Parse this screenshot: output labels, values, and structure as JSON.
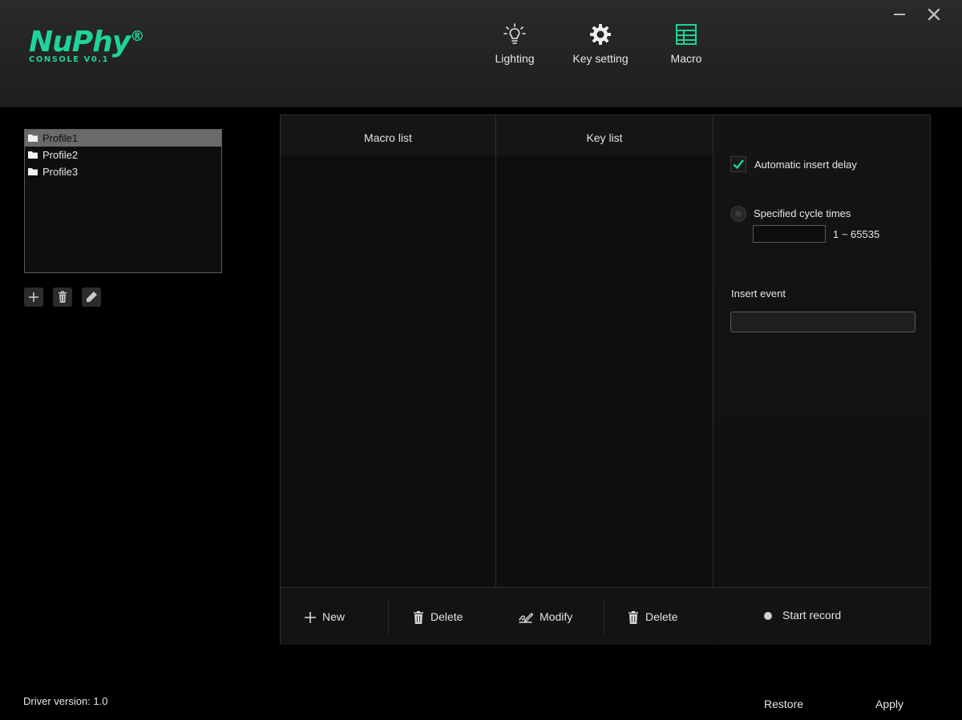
{
  "brand": {
    "name": "NuPhy",
    "registered": "®",
    "subtitle": "CONSOLE V0.1",
    "accent_color": "#1fd39a"
  },
  "nav": {
    "tabs": [
      {
        "label": "Lighting",
        "icon": "lightbulb-icon",
        "active": false
      },
      {
        "label": "Key setting",
        "icon": "gear-icon",
        "active": false
      },
      {
        "label": "Macro",
        "icon": "table-icon",
        "active": true
      }
    ]
  },
  "window_controls": {
    "minimize": "minimize-icon",
    "close": "close-icon"
  },
  "profiles": {
    "items": [
      {
        "label": "Profile1",
        "selected": true
      },
      {
        "label": "Profile2",
        "selected": false
      },
      {
        "label": "Profile3",
        "selected": false
      }
    ],
    "actions": [
      "add-icon",
      "trash-icon",
      "pencil-icon"
    ]
  },
  "macro": {
    "macro_list_title": "Macro list",
    "key_list_title": "Key list",
    "new_label": "New",
    "delete_label": "Delete",
    "modify_label": "Modify",
    "key_delete_label": "Delete",
    "start_record_label": "Start record"
  },
  "options": {
    "auto_delay_label": "Automatic insert delay",
    "auto_delay_checked": true,
    "cycle_label": "Specified cycle times",
    "cycle_selected": false,
    "cycle_value": "",
    "cycle_range": "1 ~ 65535",
    "insert_event_label": "Insert event",
    "insert_event_value": ""
  },
  "footer": {
    "driver_version": "Driver version:  1.0",
    "restore_label": "Restore",
    "apply_label": "Apply"
  }
}
